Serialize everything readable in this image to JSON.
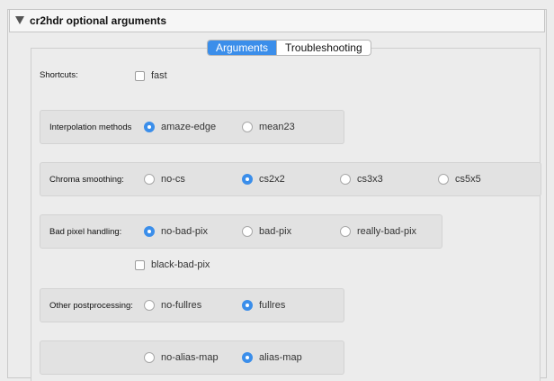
{
  "section": {
    "title": "cr2hdr optional arguments"
  },
  "tabs": [
    {
      "label": "Arguments",
      "active": true
    },
    {
      "label": "Troubleshooting",
      "active": false
    }
  ],
  "shortcuts": {
    "label": "Shortcuts:",
    "fast": {
      "label": "fast",
      "checked": false
    }
  },
  "interpolation": {
    "label": "Interpolation methods",
    "options": [
      {
        "label": "amaze-edge",
        "selected": true
      },
      {
        "label": "mean23",
        "selected": false
      }
    ]
  },
  "chroma": {
    "label": "Chroma smoothing:",
    "options": [
      {
        "label": "no-cs",
        "selected": false
      },
      {
        "label": "cs2x2",
        "selected": true
      },
      {
        "label": "cs3x3",
        "selected": false
      },
      {
        "label": "cs5x5",
        "selected": false
      }
    ]
  },
  "badpix": {
    "label": "Bad pixel handling:",
    "options": [
      {
        "label": "no-bad-pix",
        "selected": true
      },
      {
        "label": "bad-pix",
        "selected": false
      },
      {
        "label": "really-bad-pix",
        "selected": false
      }
    ],
    "black_bad_pix": {
      "label": "black-bad-pix",
      "checked": false
    }
  },
  "postprocessing": {
    "label": "Other postprocessing:",
    "options": [
      {
        "label": "no-fullres",
        "selected": false
      },
      {
        "label": "fullres",
        "selected": true
      }
    ]
  },
  "aliasmap": {
    "label": "",
    "options": [
      {
        "label": "no-alias-map",
        "selected": false
      },
      {
        "label": "alias-map",
        "selected": true
      }
    ]
  },
  "colors": {
    "accent": "#3b8eea",
    "group_bg": "#e2e2e2"
  }
}
